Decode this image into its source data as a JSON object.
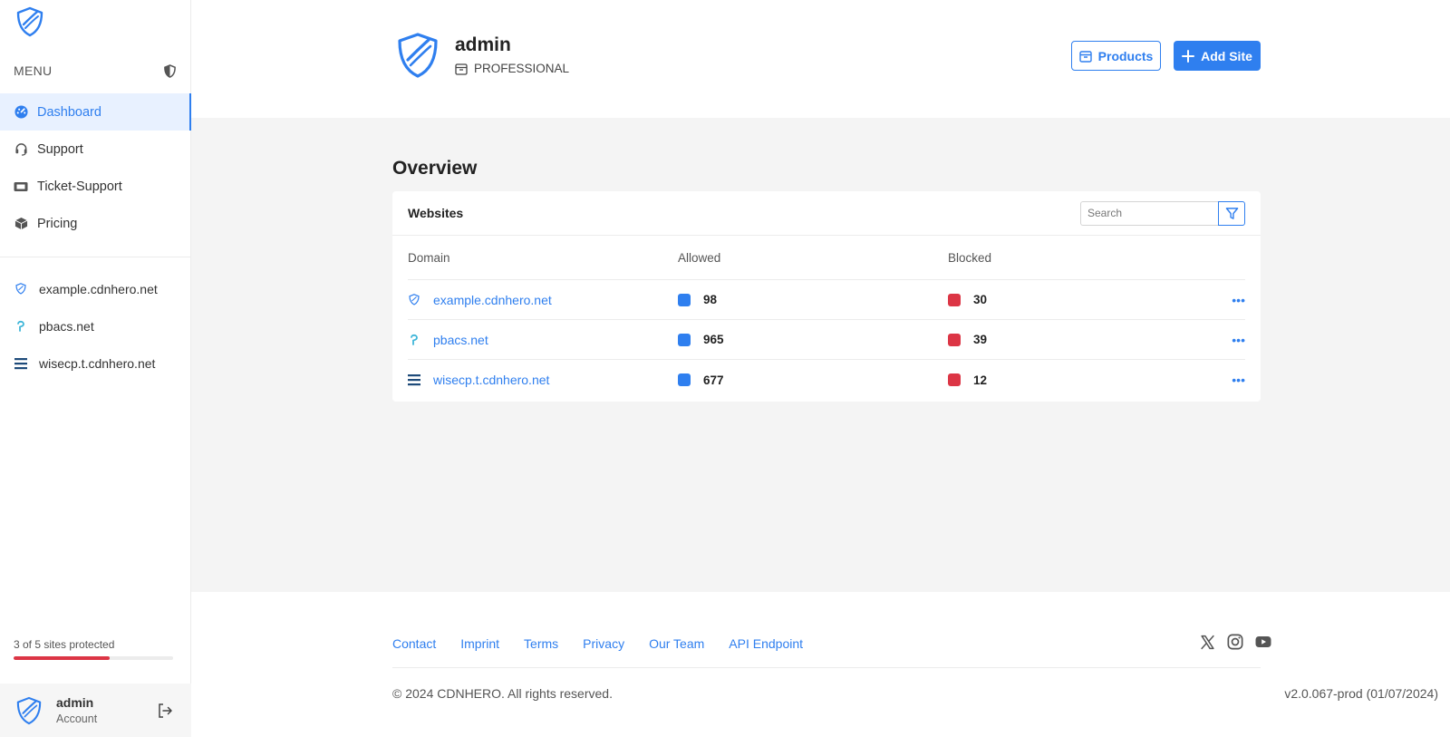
{
  "sidebar": {
    "menu_label": "MENU",
    "nav": [
      {
        "label": "Dashboard",
        "icon": "dashboard-icon",
        "active": true
      },
      {
        "label": "Support",
        "icon": "headset-icon"
      },
      {
        "label": "Ticket-Support",
        "icon": "ticket-icon"
      },
      {
        "label": "Pricing",
        "icon": "box-icon"
      }
    ],
    "sites": [
      {
        "label": "example.cdnhero.net",
        "icon": "shield-icon"
      },
      {
        "label": "pbacs.net",
        "icon": "p-logo-icon"
      },
      {
        "label": "wisecp.t.cdnhero.net",
        "icon": "bars-icon"
      }
    ],
    "protection": {
      "text": "3 of 5 sites protected",
      "protected": 3,
      "total": 5
    },
    "account": {
      "name": "admin",
      "role": "Account"
    }
  },
  "header": {
    "username": "admin",
    "plan": "PROFESSIONAL",
    "products_label": "Products",
    "add_site_label": "Add Site"
  },
  "overview": {
    "title": "Overview",
    "card_title": "Websites",
    "search_placeholder": "Search",
    "columns": {
      "domain": "Domain",
      "allowed": "Allowed",
      "blocked": "Blocked"
    },
    "rows": [
      {
        "domain": "example.cdnhero.net",
        "allowed": "98",
        "blocked": "30",
        "more": "•••"
      },
      {
        "domain": "pbacs.net",
        "allowed": "965",
        "blocked": "39",
        "more": "•••"
      },
      {
        "domain": "wisecp.t.cdnhero.net",
        "allowed": "677",
        "blocked": "12",
        "more": "•••"
      }
    ]
  },
  "footer": {
    "links": [
      "Contact",
      "Imprint",
      "Terms",
      "Privacy",
      "Our Team",
      "API Endpoint"
    ],
    "copyright": "© 2024 CDNHERO. All rights reserved.",
    "version": "v2.0.067-prod (01/07/2024)"
  },
  "colors": {
    "accent": "#2f7fef",
    "allowed": "#2f7fef",
    "blocked": "#dc3545",
    "progress": "#dc3545",
    "content_bg": "#f4f4f4"
  }
}
